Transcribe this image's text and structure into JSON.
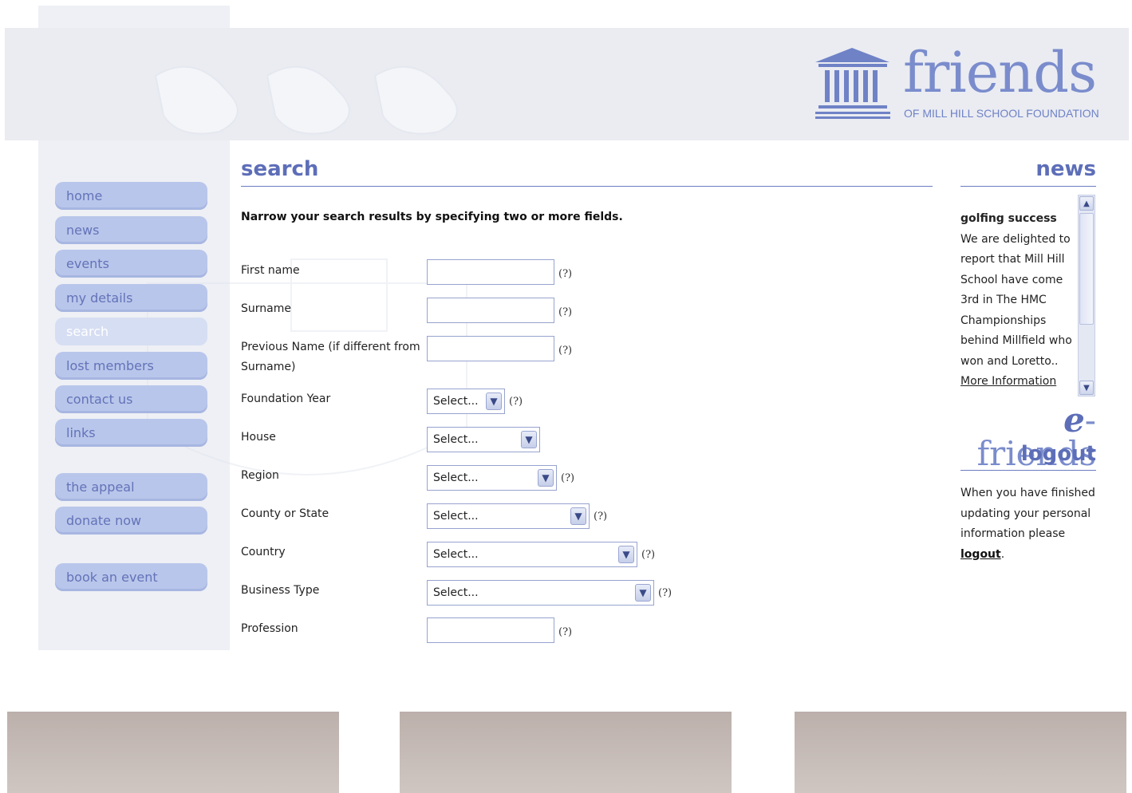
{
  "brand": {
    "name": "friends",
    "subtitle": "OF MILL HILL SCHOOL FOUNDATION",
    "accent": "#5d6eb8",
    "nav_color": "#b9c6eb"
  },
  "nav": {
    "items": [
      {
        "label": "home"
      },
      {
        "label": "news"
      },
      {
        "label": "events"
      },
      {
        "label": "my details"
      },
      {
        "label": "search",
        "active": true
      },
      {
        "label": "lost members"
      },
      {
        "label": "contact us"
      },
      {
        "label": "links"
      },
      {
        "label": "the appeal"
      },
      {
        "label": "donate now"
      },
      {
        "label": "book an event"
      }
    ]
  },
  "main": {
    "title": "search",
    "intro": "Narrow your search results by specifying two or more fields.",
    "help_symbol": "(?)",
    "fields": {
      "first_name": {
        "label": "First name",
        "value": ""
      },
      "surname": {
        "label": "Surname",
        "value": ""
      },
      "previous_name": {
        "label": "Previous Name (if different from Surname)",
        "value": ""
      },
      "foundation_year": {
        "label": "Foundation Year",
        "selected": "Select..."
      },
      "house": {
        "label": "House",
        "selected": "Select..."
      },
      "region": {
        "label": "Region",
        "selected": "Select..."
      },
      "county": {
        "label": "County or State",
        "selected": "Select..."
      },
      "country": {
        "label": "Country",
        "selected": "Select..."
      },
      "business_type": {
        "label": "Business Type",
        "selected": "Select..."
      },
      "profession": {
        "label": "Profession",
        "value": ""
      }
    }
  },
  "news": {
    "title": "news",
    "headline": "golfing success",
    "body": "We are delighted to report that Mill Hill School have come 3rd in The HMC Championships behind Millfield who won and Loretto..",
    "more_link": "More Information"
  },
  "efriends": {
    "prefix": "e",
    "word": "-friends",
    "logout_title": "logout",
    "logout_text": "When you have finished updating your personal information please",
    "logout_link": "logout",
    "logout_period": "."
  }
}
